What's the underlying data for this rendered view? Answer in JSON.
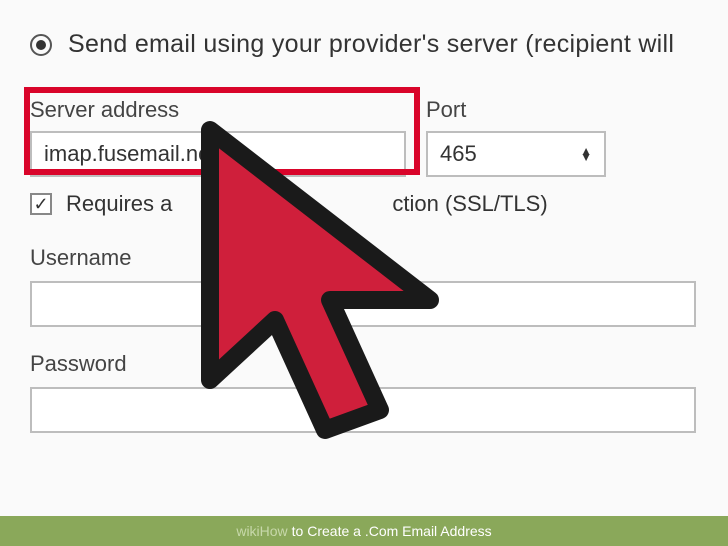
{
  "radio": {
    "label": "Send email using your provider's server (recipient will"
  },
  "server": {
    "label": "Server address",
    "value": "imap.fusemail.net."
  },
  "port": {
    "label": "Port",
    "value": "465"
  },
  "ssl": {
    "prefix": "Requires a",
    "suffix": "ction (SSL/TLS)"
  },
  "username": {
    "label": "Username",
    "value": ""
  },
  "password": {
    "label": "Password",
    "value": ""
  },
  "caption": {
    "prefix": "wikiHow",
    "text": " to Create a .Com Email Address"
  },
  "colors": {
    "highlight": "#d9042a",
    "cursor_fill": "#cf1f3b",
    "caption_bg": "#8aa85a"
  }
}
